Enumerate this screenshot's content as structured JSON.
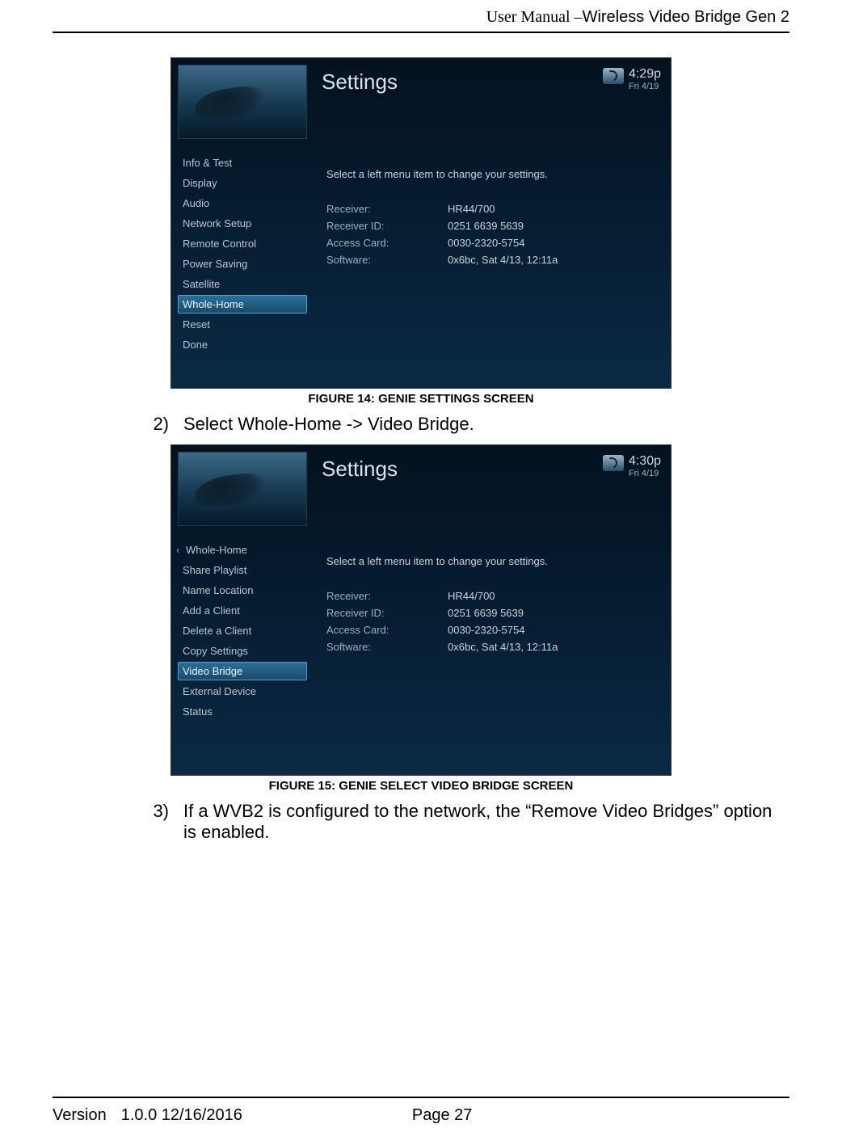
{
  "header": {
    "prefix": "User Manual –",
    "title": "Wireless Video Bridge Gen 2"
  },
  "footer": {
    "version_label": "Version",
    "version_value": "1.0.0 12/16/2016",
    "page": "Page 27"
  },
  "figure1": {
    "caption": "FIGURE 14:  GENIE SETTINGS SCREEN",
    "title": "Settings",
    "clock_time": "4:29p",
    "clock_date": "Fri 4/19",
    "instruction": "Select a left menu item to change your settings.",
    "menu": [
      "Info & Test",
      "Display",
      "Audio",
      "Network Setup",
      "Remote Control",
      "Power Saving",
      "Satellite",
      "Whole-Home",
      "Reset",
      "Done"
    ],
    "selected_index": 7,
    "details": {
      "receiver_label": "Receiver:",
      "receiver_value": "HR44/700",
      "receiver_id_label": "Receiver ID:",
      "receiver_id_value": "0251 6639 5639",
      "access_card_label": "Access Card:",
      "access_card_value": "0030-2320-5754",
      "software_label": "Software:",
      "software_value": "0x6bc, Sat 4/13, 12:11a"
    }
  },
  "step2": {
    "num": "2)",
    "text": "Select Whole-Home -> Video Bridge."
  },
  "figure2": {
    "caption": "FIGURE 15:  GENIE SELECT VIDEO BRIDGE SCREEN",
    "title": "Settings",
    "clock_time": "4:30p",
    "clock_date": "Fri 4/19",
    "instruction": "Select a left menu item to change your settings.",
    "breadcrumb": "Whole-Home",
    "menu": [
      "Share Playlist",
      "Name Location",
      "Add a Client",
      "Delete a Client",
      "Copy Settings",
      "Video Bridge",
      "External Device",
      "Status"
    ],
    "selected_index": 5,
    "details": {
      "receiver_label": "Receiver:",
      "receiver_value": "HR44/700",
      "receiver_id_label": "Receiver ID:",
      "receiver_id_value": "0251 6639 5639",
      "access_card_label": "Access Card:",
      "access_card_value": "0030-2320-5754",
      "software_label": "Software:",
      "software_value": "0x6bc, Sat 4/13, 12:11a"
    }
  },
  "step3": {
    "num": "3)",
    "text": "If a WVB2 is configured to the network, the “Remove Video Bridges” option is enabled."
  }
}
